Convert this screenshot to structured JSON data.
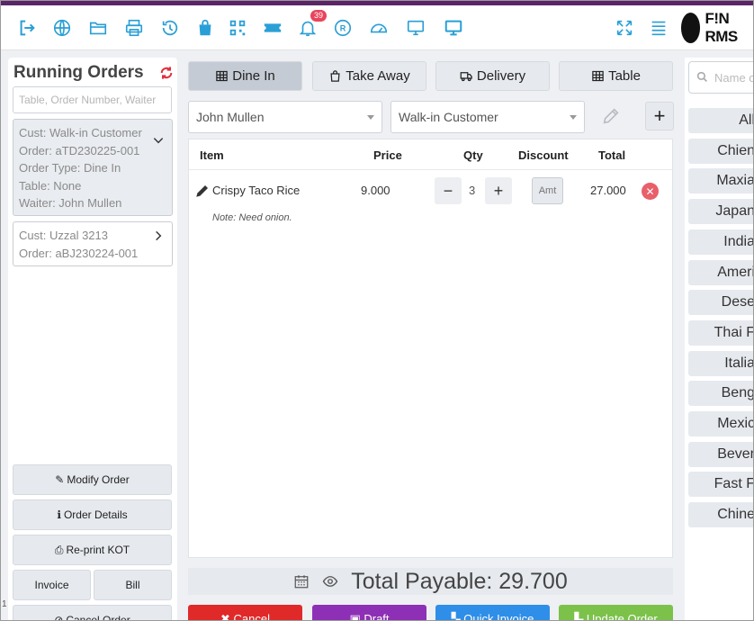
{
  "toolbar": {
    "icons": [
      "logout-icon",
      "globe-icon",
      "folder-icon",
      "printer-icon",
      "history-icon",
      "shopping-bag-icon",
      "qr-code-icon",
      "ticket-icon",
      "bell-icon",
      "registered-icon",
      "dashboard-icon",
      "monitor-icon",
      "display-icon"
    ],
    "notification_count": "39",
    "right_icons": [
      "fullscreen-icon",
      "menu-icon"
    ],
    "logo_text": "F!N RMS",
    "accent": "#5a2566"
  },
  "running_orders": {
    "title": "Running Orders",
    "search_placeholder": "Table, Order Number, Waiter",
    "orders": [
      {
        "customer": "Cust: Walk-in Customer",
        "order": "Order: aTD230225-001",
        "type": "Order Type: Dine In",
        "table": "Table: None",
        "waiter": "Waiter: John Mullen"
      },
      {
        "customer": "Cust: Uzzal 3213",
        "order": "Order: aBJ230224-001"
      }
    ],
    "buttons": {
      "modify": "Modify Order",
      "details": "Order Details",
      "reprint": "Re-print KOT",
      "invoice": "Invoice",
      "bill": "Bill",
      "cancel": "Cancel Order"
    }
  },
  "order_panel": {
    "tabs": [
      "Dine In",
      "Take Away",
      "Delivery",
      "Table"
    ],
    "active_tab": "Dine In",
    "waiter": "John Mullen",
    "customer": "Walk-in Customer",
    "columns": {
      "item": "Item",
      "price": "Price",
      "qty": "Qty",
      "discount": "Discount",
      "total": "Total"
    },
    "items": [
      {
        "name": "Crispy Taco Rice",
        "price": "9.000",
        "qty": "3",
        "discount_placeholder": "Amt",
        "total": "27.000",
        "note": "Note: Need onion."
      }
    ],
    "total_payable": "Total Payable: 29.700",
    "actions": [
      {
        "label": "Cancel",
        "color": "#e02a2a"
      },
      {
        "label": "Draft",
        "color": "#8e30b5"
      },
      {
        "label": "Quick Invoice",
        "color": "#2f8ee8"
      },
      {
        "label": "Update Order",
        "color": "#7cc24a"
      }
    ]
  },
  "categories": {
    "search_placeholder": "Name or",
    "items": [
      "All",
      "Chien",
      "Maxia",
      "Japan",
      "India",
      "Ameri",
      "Dese",
      "Thai F",
      "Italia",
      "Beng",
      "Mexic",
      "Bever",
      "Fast F",
      "Chine"
    ]
  },
  "edge_mark": "1"
}
